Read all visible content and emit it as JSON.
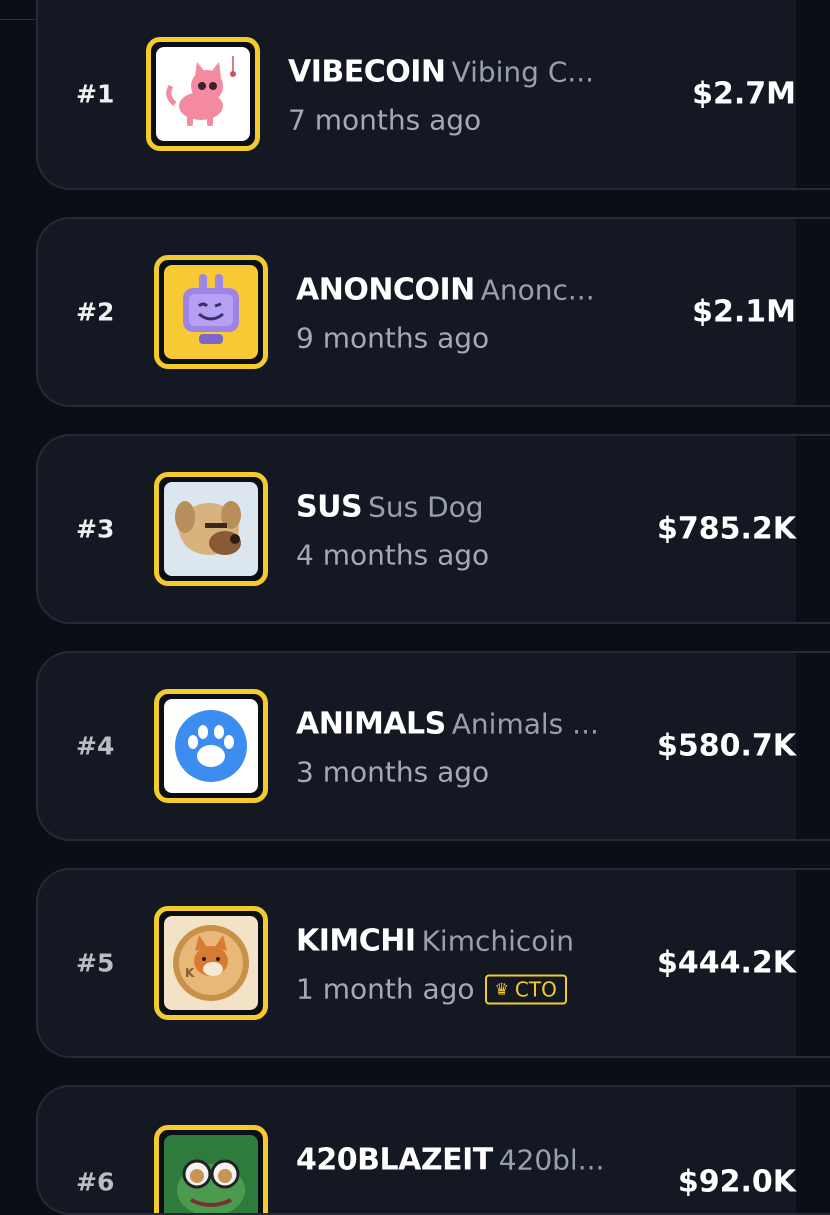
{
  "coins": [
    {
      "rank": "#1",
      "ticker": "VIBECOIN",
      "name": "Vibing C...",
      "age": "7 months ago",
      "market_cap": "$2.7M",
      "icon": "cat-icon",
      "badge": null
    },
    {
      "rank": "#2",
      "ticker": "ANONCOIN",
      "name": "Anonc...",
      "age": "9 months ago",
      "market_cap": "$2.1M",
      "icon": "robot-tv-icon",
      "badge": null
    },
    {
      "rank": "#3",
      "ticker": "SUS",
      "name": "Sus Dog",
      "age": "4 months ago",
      "market_cap": "$785.2K",
      "icon": "dog-icon",
      "badge": null
    },
    {
      "rank": "#4",
      "ticker": "ANIMALS",
      "name": "Animals ...",
      "age": "3 months ago",
      "market_cap": "$580.7K",
      "icon": "paw-icon",
      "badge": null
    },
    {
      "rank": "#5",
      "ticker": "KIMCHI",
      "name": "Kimchicoin",
      "age": "1 month ago",
      "market_cap": "$444.2K",
      "icon": "shiba-coin-icon",
      "badge": "CTO"
    },
    {
      "rank": "#6",
      "ticker": "420BLAZEIT",
      "name": "420bl...",
      "age": "",
      "market_cap": "$92.0K",
      "icon": "frog-icon",
      "badge": null
    }
  ],
  "colors": {
    "background": "#0b0e14",
    "card": "#131822",
    "card_border": "#242b36",
    "accent_yellow": "#f4cb2c",
    "muted_text": "#a4a9b2"
  }
}
